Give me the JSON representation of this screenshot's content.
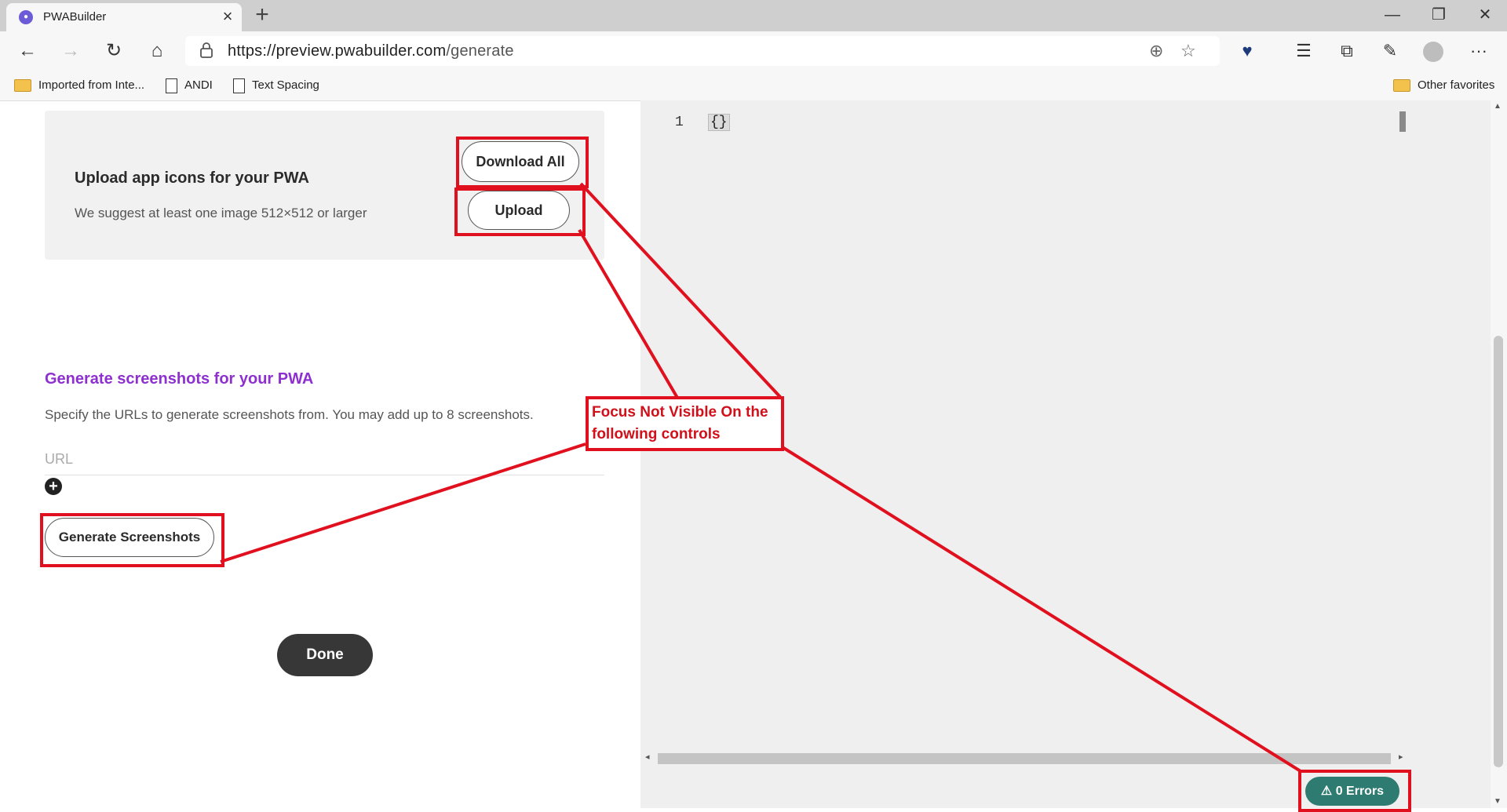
{
  "browser": {
    "tab_title": "PWABuilder",
    "tab_close": "×",
    "new_tab": "+",
    "window_controls": {
      "minimize": "—",
      "restore": "❐",
      "close": "✕"
    },
    "url_host": "https://preview.pwabuilder.com",
    "url_path": "/generate",
    "favorites": [
      "Imported from Inte...",
      "ANDI",
      "Text Spacing"
    ],
    "other_favorites": "Other favorites",
    "icons": [
      "back-icon",
      "forward-icon",
      "refresh-icon",
      "home-icon",
      "lock-icon",
      "add-to-favorites-icon",
      "star-icon",
      "heart-extension-icon",
      "favorites-icon",
      "collections-icon",
      "feedback-icon",
      "profile-icon",
      "more-icon"
    ]
  },
  "icons_section": {
    "heading": "Upload app icons for your PWA",
    "subtext": "We suggest at least one image 512×512 or larger",
    "download_all_label": "Download All",
    "upload_label": "Upload"
  },
  "screenshots_section": {
    "heading": "Generate screenshots for your PWA",
    "description": "Specify the URLs to generate screenshots from. You may add up to 8 screenshots.",
    "url_placeholder": "URL",
    "generate_label": "Generate Screenshots"
  },
  "done_label": "Done",
  "editor": {
    "line_number": "1",
    "code": "{}",
    "errors_label": "0 Errors"
  },
  "annotation": {
    "text": "Focus Not Visible On the following controls",
    "color": "#e0101e"
  }
}
